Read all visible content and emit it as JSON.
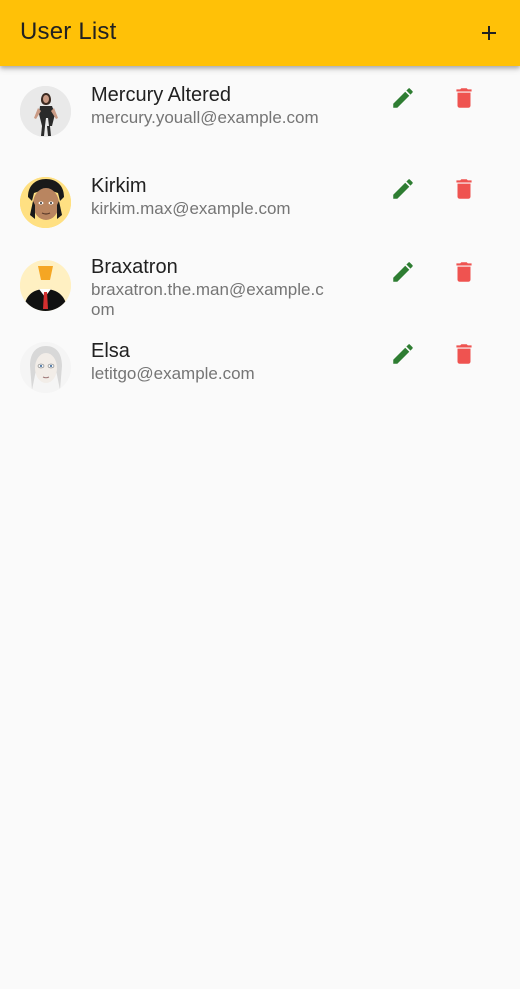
{
  "app_bar": {
    "title": "User List",
    "add_icon": "plus-icon",
    "background": "#ffc107"
  },
  "users": [
    {
      "name": "Mercury Altered",
      "email": "mercury.youall@example.com"
    },
    {
      "name": "Kirkim",
      "email": "kirkim.max@example.com"
    },
    {
      "name": "Braxatron",
      "email": "braxatron.the.man@example.com"
    },
    {
      "name": "Elsa",
      "email": "letitgo@example.com"
    }
  ],
  "row_actions": {
    "edit_icon": "pencil-icon",
    "delete_icon": "trash-icon",
    "edit_color": "#2e7d32",
    "delete_color": "#ef5350"
  }
}
